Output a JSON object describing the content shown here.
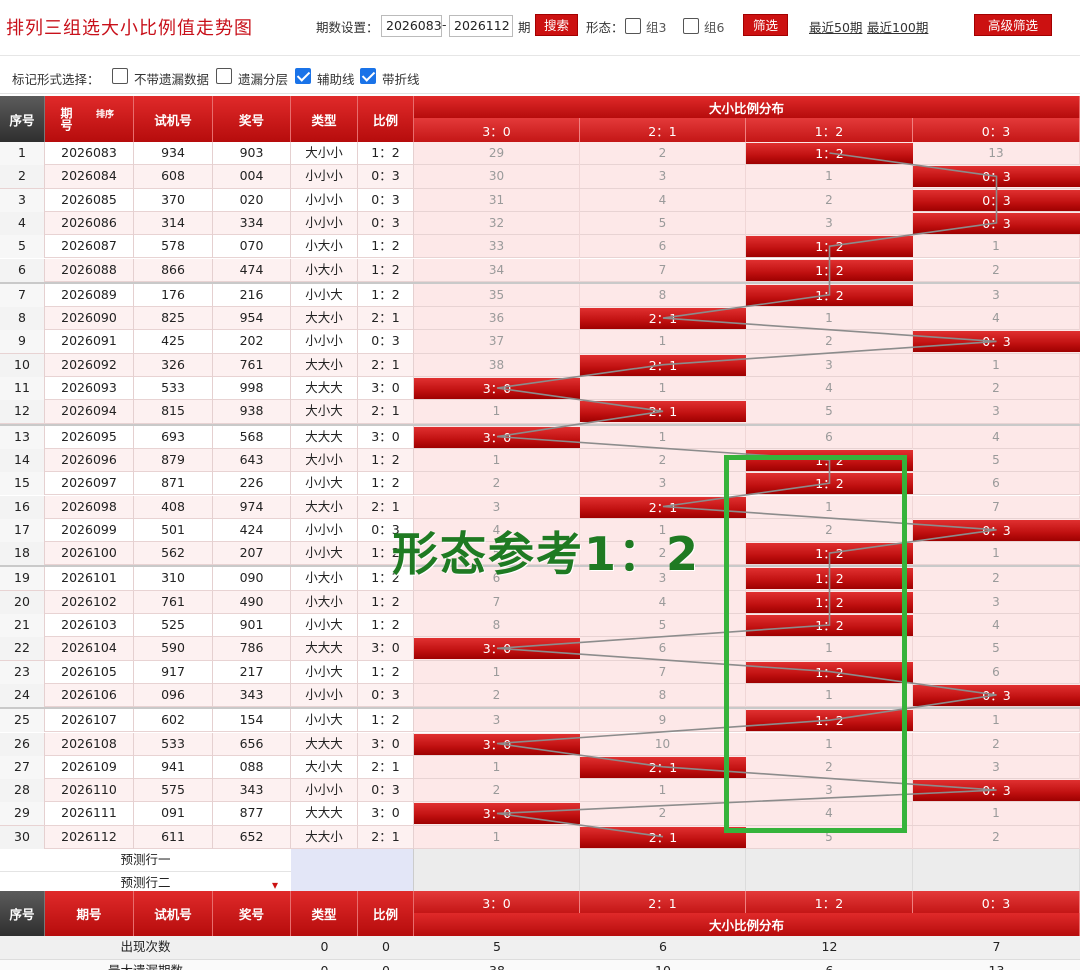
{
  "header": {
    "title": "排列三组选大小比例值走势图",
    "period_label": "期数设置：",
    "period_from": "2026083",
    "period_sep": "-",
    "period_to": "2026112",
    "period_unit": "期",
    "search_label": "搜索",
    "form_label": "形态：",
    "group3_label": "组3",
    "group6_label": "组6",
    "filter_label": "筛选",
    "recent50_label": "最近50期",
    "recent100_label": "最近100期",
    "advanced_label": "高级筛选"
  },
  "marks": {
    "title": "标记形式选择：",
    "options": [
      {
        "label": "不带遗漏数据",
        "checked": false
      },
      {
        "label": "遗漏分层",
        "checked": false
      },
      {
        "label": "辅助线",
        "checked": true
      },
      {
        "label": "带折线",
        "checked": true
      }
    ]
  },
  "table": {
    "head": {
      "index": "序号",
      "period": "期号",
      "sort": "排序",
      "trial": "试机号",
      "draw": "奖号",
      "type": "类型",
      "ratio": "比例",
      "dist": "大小比例分布",
      "cols": [
        "3：0",
        "2：1",
        "1：2",
        "0：3"
      ]
    },
    "rows": [
      {
        "n": "1",
        "period": "2026083",
        "trial": "934",
        "draw": "903",
        "type": "大小小",
        "ratio": "1：2",
        "hit": 2,
        "miss": [
          "29",
          "2",
          "",
          "13"
        ]
      },
      {
        "n": "2",
        "period": "2026084",
        "trial": "608",
        "draw": "004",
        "type": "小小小",
        "ratio": "0：3",
        "hit": 3,
        "miss": [
          "30",
          "3",
          "1",
          ""
        ]
      },
      {
        "n": "3",
        "period": "2026085",
        "trial": "370",
        "draw": "020",
        "type": "小小小",
        "ratio": "0：3",
        "hit": 3,
        "miss": [
          "31",
          "4",
          "2",
          ""
        ]
      },
      {
        "n": "4",
        "period": "2026086",
        "trial": "314",
        "draw": "334",
        "type": "小小小",
        "ratio": "0：3",
        "hit": 3,
        "miss": [
          "32",
          "5",
          "3",
          ""
        ]
      },
      {
        "n": "5",
        "period": "2026087",
        "trial": "578",
        "draw": "070",
        "type": "小大小",
        "ratio": "1：2",
        "hit": 2,
        "miss": [
          "33",
          "6",
          "",
          "1"
        ]
      },
      {
        "n": "6",
        "period": "2026088",
        "trial": "866",
        "draw": "474",
        "type": "小大小",
        "ratio": "1：2",
        "hit": 2,
        "miss": [
          "34",
          "7",
          "",
          "2"
        ]
      },
      {
        "n": "7",
        "period": "2026089",
        "trial": "176",
        "draw": "216",
        "type": "小小大",
        "ratio": "1：2",
        "hit": 2,
        "miss": [
          "35",
          "8",
          "",
          "3"
        ]
      },
      {
        "n": "8",
        "period": "2026090",
        "trial": "825",
        "draw": "954",
        "type": "大大小",
        "ratio": "2：1",
        "hit": 1,
        "miss": [
          "36",
          "",
          "1",
          "4"
        ]
      },
      {
        "n": "9",
        "period": "2026091",
        "trial": "425",
        "draw": "202",
        "type": "小小小",
        "ratio": "0：3",
        "hit": 3,
        "miss": [
          "37",
          "1",
          "2",
          ""
        ]
      },
      {
        "n": "10",
        "period": "2026092",
        "trial": "326",
        "draw": "761",
        "type": "大大小",
        "ratio": "2：1",
        "hit": 1,
        "miss": [
          "38",
          "",
          "3",
          "1"
        ]
      },
      {
        "n": "11",
        "period": "2026093",
        "trial": "533",
        "draw": "998",
        "type": "大大大",
        "ratio": "3：0",
        "hit": 0,
        "miss": [
          "",
          "1",
          "4",
          "2"
        ]
      },
      {
        "n": "12",
        "period": "2026094",
        "trial": "815",
        "draw": "938",
        "type": "大小大",
        "ratio": "2：1",
        "hit": 1,
        "miss": [
          "1",
          "",
          "5",
          "3"
        ]
      },
      {
        "n": "13",
        "period": "2026095",
        "trial": "693",
        "draw": "568",
        "type": "大大大",
        "ratio": "3：0",
        "hit": 0,
        "miss": [
          "",
          "1",
          "6",
          "4"
        ]
      },
      {
        "n": "14",
        "period": "2026096",
        "trial": "879",
        "draw": "643",
        "type": "大小小",
        "ratio": "1：2",
        "hit": 2,
        "miss": [
          "1",
          "2",
          "",
          "5"
        ]
      },
      {
        "n": "15",
        "period": "2026097",
        "trial": "871",
        "draw": "226",
        "type": "小小大",
        "ratio": "1：2",
        "hit": 2,
        "miss": [
          "2",
          "3",
          "",
          "6"
        ]
      },
      {
        "n": "16",
        "period": "2026098",
        "trial": "408",
        "draw": "974",
        "type": "大大小",
        "ratio": "2：1",
        "hit": 1,
        "miss": [
          "3",
          "",
          "1",
          "7"
        ]
      },
      {
        "n": "17",
        "period": "2026099",
        "trial": "501",
        "draw": "424",
        "type": "小小小",
        "ratio": "0：3",
        "hit": 3,
        "miss": [
          "4",
          "1",
          "2",
          ""
        ]
      },
      {
        "n": "18",
        "period": "2026100",
        "trial": "562",
        "draw": "207",
        "type": "小小大",
        "ratio": "1：2",
        "hit": 2,
        "miss": [
          "5",
          "2",
          "",
          "1"
        ]
      },
      {
        "n": "19",
        "period": "2026101",
        "trial": "310",
        "draw": "090",
        "type": "小大小",
        "ratio": "1：2",
        "hit": 2,
        "miss": [
          "6",
          "3",
          "",
          "2"
        ]
      },
      {
        "n": "20",
        "period": "2026102",
        "trial": "761",
        "draw": "490",
        "type": "小大小",
        "ratio": "1：2",
        "hit": 2,
        "miss": [
          "7",
          "4",
          "",
          "3"
        ]
      },
      {
        "n": "21",
        "period": "2026103",
        "trial": "525",
        "draw": "901",
        "type": "小小大",
        "ratio": "1：2",
        "hit": 2,
        "miss": [
          "8",
          "5",
          "",
          "4"
        ]
      },
      {
        "n": "22",
        "period": "2026104",
        "trial": "590",
        "draw": "786",
        "type": "大大大",
        "ratio": "3：0",
        "hit": 0,
        "miss": [
          "",
          "6",
          "1",
          "5"
        ]
      },
      {
        "n": "23",
        "period": "2026105",
        "trial": "917",
        "draw": "217",
        "type": "小小大",
        "ratio": "1：2",
        "hit": 2,
        "miss": [
          "1",
          "7",
          "",
          "6"
        ]
      },
      {
        "n": "24",
        "period": "2026106",
        "trial": "096",
        "draw": "343",
        "type": "小小小",
        "ratio": "0：3",
        "hit": 3,
        "miss": [
          "2",
          "8",
          "1",
          ""
        ]
      },
      {
        "n": "25",
        "period": "2026107",
        "trial": "602",
        "draw": "154",
        "type": "小小大",
        "ratio": "1：2",
        "hit": 2,
        "miss": [
          "3",
          "9",
          "",
          "1"
        ]
      },
      {
        "n": "26",
        "period": "2026108",
        "trial": "533",
        "draw": "656",
        "type": "大大大",
        "ratio": "3：0",
        "hit": 0,
        "miss": [
          "",
          "10",
          "1",
          "2"
        ]
      },
      {
        "n": "27",
        "period": "2026109",
        "trial": "941",
        "draw": "088",
        "type": "大小大",
        "ratio": "2：1",
        "hit": 1,
        "miss": [
          "1",
          "",
          "2",
          "3"
        ]
      },
      {
        "n": "28",
        "period": "2026110",
        "trial": "575",
        "draw": "343",
        "type": "小小小",
        "ratio": "0：3",
        "hit": 3,
        "miss": [
          "2",
          "1",
          "3",
          ""
        ]
      },
      {
        "n": "29",
        "period": "2026111",
        "trial": "091",
        "draw": "877",
        "type": "大大大",
        "ratio": "3：0",
        "hit": 0,
        "miss": [
          "",
          "2",
          "4",
          "1"
        ]
      },
      {
        "n": "30",
        "period": "2026112",
        "trial": "611",
        "draw": "652",
        "type": "大大小",
        "ratio": "2：1",
        "hit": 1,
        "miss": [
          "1",
          "",
          "5",
          "2"
        ]
      }
    ],
    "predict": [
      "预测行一",
      "预测行二"
    ],
    "stats": {
      "label": "出现次数",
      "type": "0",
      "ratio": "0",
      "counts": [
        "5",
        "6",
        "12",
        "7"
      ]
    },
    "partial_row": {
      "label": "最大遗漏期数",
      "type": "0",
      "ratio": "0",
      "counts": [
        "38",
        "10",
        "6",
        "13"
      ]
    }
  },
  "overlay": {
    "text": "形态参考1：2",
    "box_color": "#36b33b",
    "text_color": "#1f7a22"
  },
  "colors": {
    "brand_red": "#c8101a",
    "hit_red": "#cc1111",
    "checkbox_blue": "#1a73e8",
    "row_pink": "#fde8e8"
  }
}
